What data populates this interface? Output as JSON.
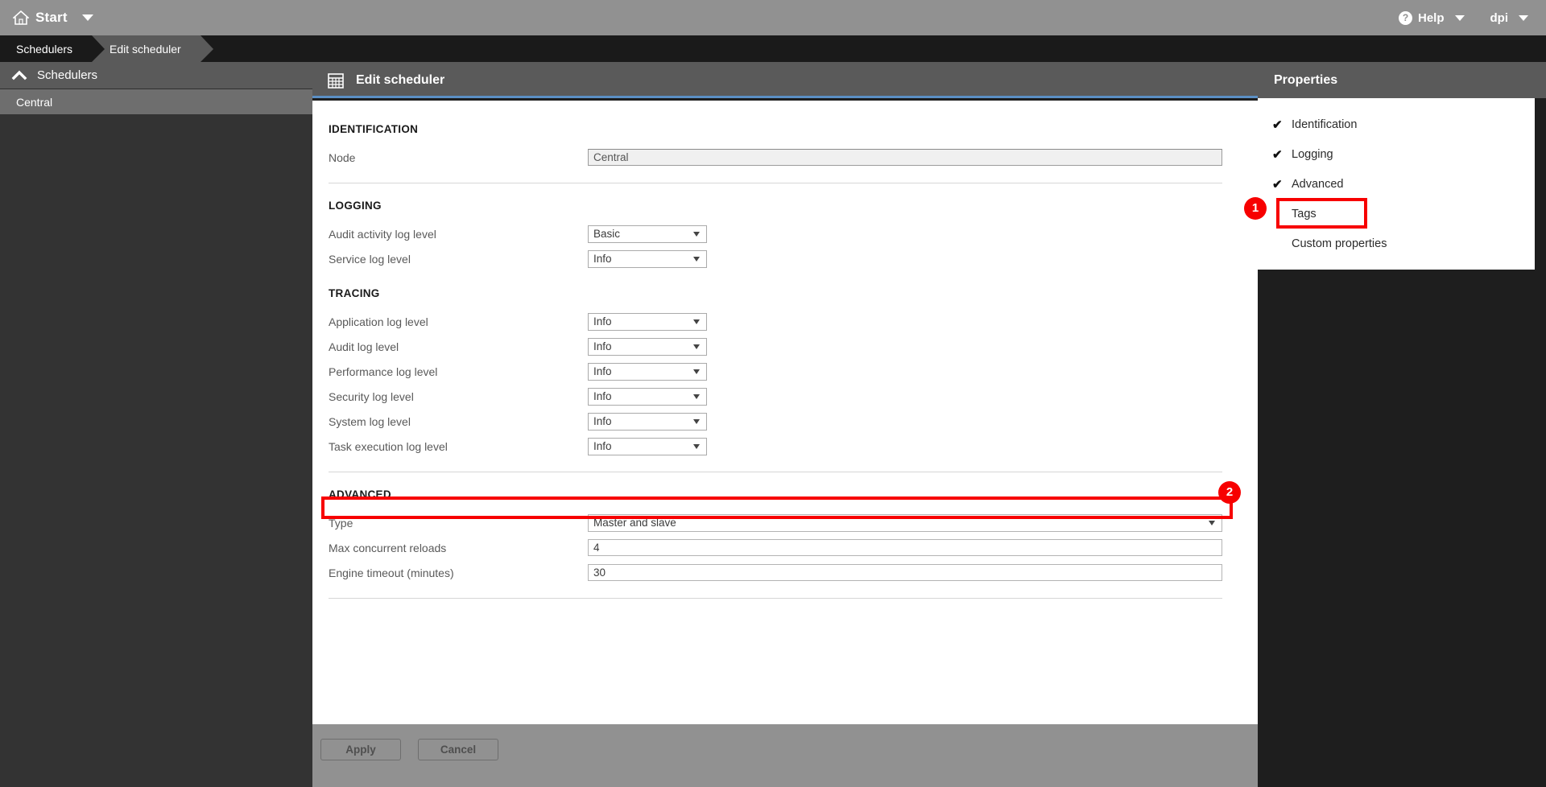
{
  "topbar": {
    "home_icon": "home-icon",
    "start_label": "Start",
    "start_caret": "chevron-down-icon",
    "help_icon": "?",
    "help_label": "Help",
    "help_caret": "chevron-down-icon",
    "dpi_label": "dpi",
    "dpi_caret": "chevron-down-icon"
  },
  "breadcrumb": {
    "items": [
      {
        "label": "Schedulers"
      },
      {
        "label": "Edit scheduler"
      }
    ]
  },
  "sidebar": {
    "header": {
      "label": "Schedulers",
      "icon": "chevron-up-icon"
    },
    "items": [
      {
        "label": "Central",
        "selected": true
      }
    ]
  },
  "main": {
    "header": {
      "icon": "calendar-icon",
      "title": "Edit scheduler"
    },
    "sections": [
      {
        "title": "IDENTIFICATION",
        "fields": [
          {
            "label": "Node",
            "type": "text",
            "value": "Central",
            "readonly": true
          }
        ]
      },
      {
        "title": "LOGGING",
        "fields": [
          {
            "label": "Audit activity log level",
            "type": "select",
            "value": "Basic"
          },
          {
            "label": "Service log level",
            "type": "select",
            "value": "Info"
          }
        ]
      },
      {
        "title": "TRACING",
        "fields": [
          {
            "label": "Application log level",
            "type": "select",
            "value": "Info"
          },
          {
            "label": "Audit log level",
            "type": "select",
            "value": "Info"
          },
          {
            "label": "Performance log level",
            "type": "select",
            "value": "Info"
          },
          {
            "label": "Security log level",
            "type": "select",
            "value": "Info"
          },
          {
            "label": "System log level",
            "type": "select",
            "value": "Info"
          },
          {
            "label": "Task execution log level",
            "type": "select",
            "value": "Info"
          }
        ]
      },
      {
        "title": "ADVANCED",
        "fields": [
          {
            "label": "Type",
            "type": "select-wide",
            "value": "Master and slave"
          },
          {
            "label": "Max concurrent reloads",
            "type": "text",
            "value": "4"
          },
          {
            "label": "Engine timeout (minutes)",
            "type": "text",
            "value": "30"
          }
        ]
      }
    ],
    "footer": {
      "apply_label": "Apply",
      "cancel_label": "Cancel"
    }
  },
  "properties": {
    "title": "Properties",
    "items": [
      {
        "label": "Identification",
        "checked": true,
        "check_glyph": "✔"
      },
      {
        "label": "Logging",
        "checked": true,
        "check_glyph": "✔"
      },
      {
        "label": "Advanced",
        "checked": true,
        "check_glyph": "✔"
      },
      {
        "label": "Tags",
        "checked": false,
        "check_glyph": ""
      },
      {
        "label": "Custom properties",
        "checked": false,
        "check_glyph": ""
      }
    ]
  },
  "annotations": {
    "color": "#F70000",
    "badges": [
      {
        "number": "1",
        "target": "Advanced property item"
      },
      {
        "number": "2",
        "target": "Max concurrent reloads field"
      }
    ]
  }
}
